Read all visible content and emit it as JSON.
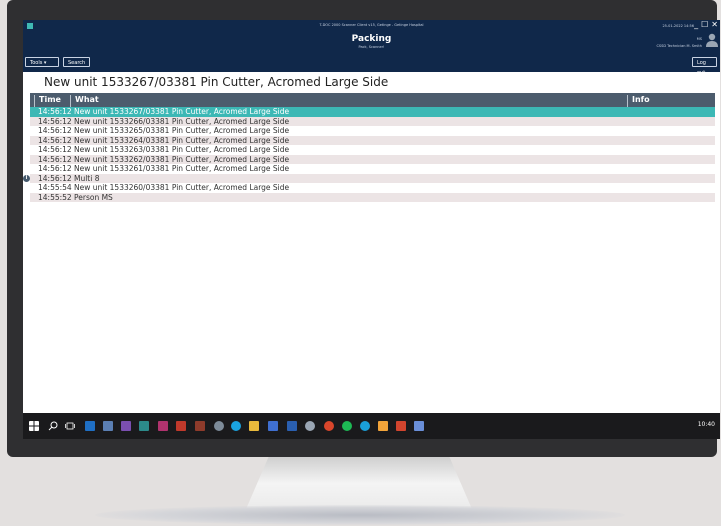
{
  "window": {
    "title": "T-DOC 2000 Scanner Client v15, Getinge - Getinge Hospital",
    "datetime": "25-01-2022 14:56",
    "controls": [
      "_",
      "☐",
      "✕"
    ]
  },
  "header": {
    "heading": "Packing",
    "subheading": "Pack, Scanner!",
    "user_initials": "MS",
    "user_role": "CSSD Technician M. Smith"
  },
  "toolbar": {
    "tools_label": "Tools ▾",
    "search_label": "Search",
    "logout_label": "Log out"
  },
  "unit_title": "New unit 1533267/03381  Pin Cutter, Acromed Large Side",
  "table": {
    "columns": {
      "time": "Time",
      "what": "What",
      "info": "Info"
    },
    "rows": [
      {
        "time": "14:56:12",
        "what": "New unit 1533267/03381  Pin Cutter, Acromed Large Side",
        "info": ""
      },
      {
        "time": "14:56:12",
        "what": "New unit 1533266/03381  Pin Cutter, Acromed Large Side",
        "info": ""
      },
      {
        "time": "14:56:12",
        "what": "New unit 1533265/03381  Pin Cutter, Acromed Large Side",
        "info": ""
      },
      {
        "time": "14:56:12",
        "what": "New unit 1533264/03381  Pin Cutter, Acromed Large Side",
        "info": ""
      },
      {
        "time": "14:56:12",
        "what": "New unit 1533263/03381  Pin Cutter, Acromed Large Side",
        "info": ""
      },
      {
        "time": "14:56:12",
        "what": "New unit 1533262/03381  Pin Cutter, Acromed Large Side",
        "info": ""
      },
      {
        "time": "14:56:12",
        "what": "New unit 1533261/03381  Pin Cutter, Acromed Large Side",
        "info": ""
      },
      {
        "time": "14:56:12",
        "what": "Multi 8",
        "info": ""
      },
      {
        "time": "14:55:54",
        "what": "New unit 1533260/03381  Pin Cutter, Acromed Large Side",
        "info": ""
      },
      {
        "time": "14:55:52",
        "what": "Person MS",
        "info": ""
      }
    ]
  },
  "taskbar": {
    "clock": "10:40"
  },
  "colors": {
    "header_bg": "#10284a",
    "selected_row": "#3cb8b5",
    "table_head": "#4c5c6d",
    "alt_row": "#ece4e5"
  }
}
